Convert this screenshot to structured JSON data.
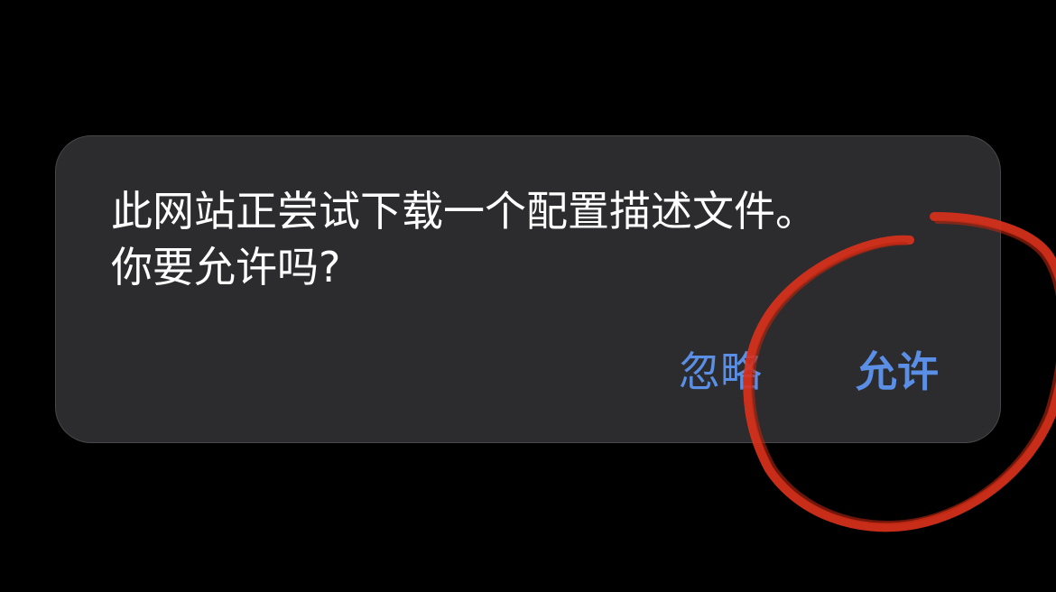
{
  "dialog": {
    "message_line1": "此网站正尝试下载一个配置描述文件。",
    "message_line2": "你要允许吗?",
    "ignore_label": "忽略",
    "allow_label": "允许"
  },
  "colors": {
    "background": "#000000",
    "dialog_bg": "#2c2c2e",
    "button_text": "#5b8fe6",
    "annotation_stroke": "#d9311c"
  }
}
